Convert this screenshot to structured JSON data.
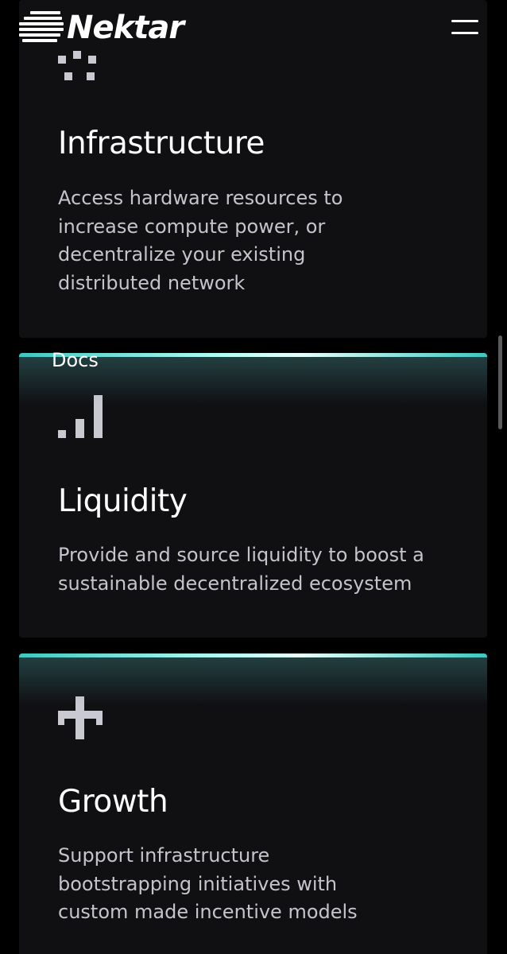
{
  "header": {
    "brand": "Nektar",
    "menu_icon": "hamburger-menu-icon"
  },
  "docs_link": "Docs",
  "cards": [
    {
      "icon": "pixel-grid-icon",
      "title": "Infrastructure",
      "description": "Access hardware resources to increase compute power, or decentralize your existing distributed network"
    },
    {
      "icon": "bar-signal-icon",
      "title": "Liquidity",
      "description": "Provide and source liquidity to boost a sustainable decentralized ecosystem"
    },
    {
      "icon": "pixel-cross-icon",
      "title": "Growth",
      "description": "Support infrastructure bootstrapping initiatives with custom made incentive models"
    }
  ],
  "colors": {
    "background": "#000000",
    "card": "#101013",
    "accent": "#3ec7c0",
    "text": "#ffffff",
    "muted_text": "#c4c4cc"
  }
}
